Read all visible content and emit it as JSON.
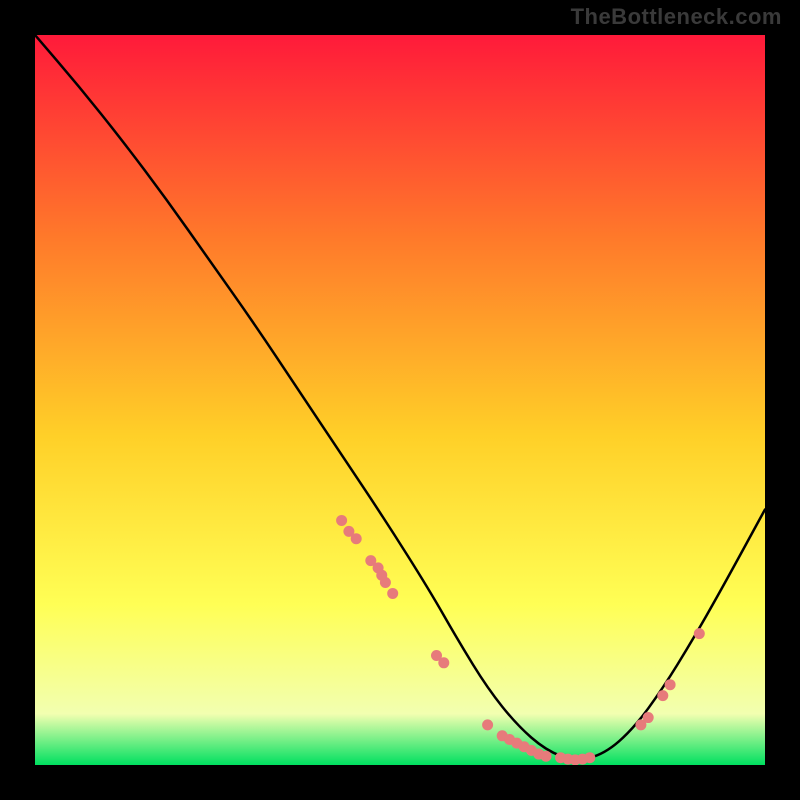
{
  "watermark": "TheBottleneck.com",
  "colors": {
    "background": "#000000",
    "curve": "#000000",
    "markers": "#e77b7b",
    "gradient_top": "#ff1a3a",
    "gradient_mid1": "#ff7a2a",
    "gradient_mid2": "#ffd028",
    "gradient_mid3": "#ffff55",
    "gradient_bottom": "#00e060"
  },
  "chart_data": {
    "type": "line",
    "title": "",
    "xlabel": "",
    "ylabel": "",
    "xlim": [
      0,
      100
    ],
    "ylim": [
      0,
      100
    ],
    "curve": {
      "x": [
        0,
        6,
        12,
        18,
        24,
        30,
        36,
        42,
        48,
        54,
        58,
        62,
        66,
        70,
        74,
        78,
        82,
        86,
        90,
        94,
        100
      ],
      "y": [
        100,
        93,
        85.5,
        77.5,
        69,
        60.5,
        51.5,
        42.5,
        33.5,
        24,
        17,
        10.5,
        5.5,
        2,
        0.5,
        1.5,
        5,
        10.5,
        17,
        24,
        35
      ]
    },
    "series": [
      {
        "name": "markers",
        "x": [
          42,
          43,
          44,
          46,
          47,
          47.5,
          48,
          49,
          55,
          56,
          62,
          64,
          65,
          66,
          67,
          68,
          69,
          70,
          72,
          73,
          74,
          75,
          76,
          83,
          84,
          86,
          87,
          91
        ],
        "y": [
          33.5,
          32,
          31,
          28,
          27,
          26,
          25,
          23.5,
          15,
          14,
          5.5,
          4,
          3.5,
          3,
          2.5,
          2,
          1.5,
          1.2,
          1,
          0.8,
          0.7,
          0.8,
          1,
          5.5,
          6.5,
          9.5,
          11,
          18
        ]
      }
    ]
  }
}
